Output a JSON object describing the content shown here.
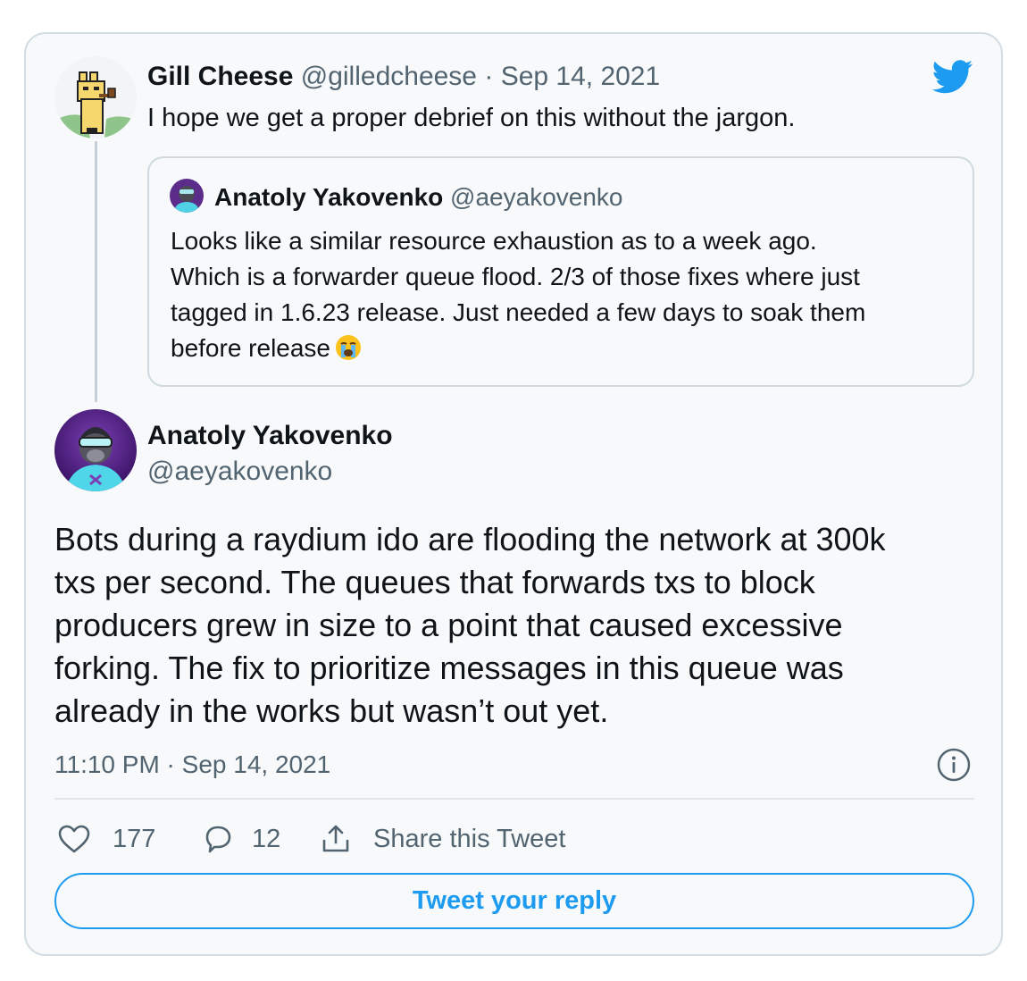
{
  "colors": {
    "accent": "#1d9bf0",
    "text_primary": "#0f1419",
    "text_secondary": "#536471",
    "card_background": "#f7f9fa",
    "border": "#cfd9de"
  },
  "icons": {
    "brand": "twitter-bird-icon",
    "info": "info-icon",
    "like": "heart-icon",
    "reply": "speech-bubble-icon",
    "share": "share-upload-icon",
    "quote_emoji": "loudly-crying-face-emoji"
  },
  "parent_tweet": {
    "author_name": "Gill Cheese",
    "author_handle": "@gilledcheese",
    "separator": "·",
    "date": "Sep 14, 2021",
    "text": "I hope we get a proper debrief on this without the jargon.",
    "quoted_tweet": {
      "author_name": "Anatoly Yakovenko",
      "author_handle": "@aeyakovenko",
      "lines": [
        "Looks like a similar resource exhaustion as to a week ago.",
        "Which is a forwarder queue flood. 2/3 of those fixes where just",
        "tagged in 1.6.23 release. Just needed a few days to soak them",
        "before release"
      ]
    }
  },
  "main_tweet": {
    "author_name": "Anatoly Yakovenko",
    "author_handle": "@aeyakovenko",
    "lines": [
      "Bots during a raydium ido are flooding the network at 300k",
      "txs per second. The queues that forwards txs to block",
      "producers grew in size to a point that caused excessive",
      "forking.  The fix to prioritize messages in this queue was",
      "already in the works but wasn’t out yet."
    ],
    "timestamp": "11:10 PM · Sep 14, 2021"
  },
  "actions": {
    "likes": "177",
    "replies": "12",
    "share_label": "Share this Tweet",
    "reply_button_label": "Tweet your reply"
  }
}
